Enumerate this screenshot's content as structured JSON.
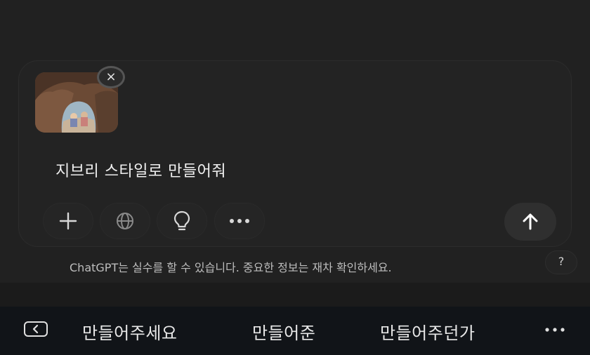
{
  "composer": {
    "attachment": {
      "icon": "image-thumbnail",
      "remove_label": "×"
    },
    "prompt_text": "지브리 스타일로 만들어줘",
    "tools": [
      {
        "icon": "plus-icon"
      },
      {
        "icon": "globe-icon"
      },
      {
        "icon": "lightbulb-icon"
      },
      {
        "icon": "more-icon"
      }
    ],
    "send_icon": "arrow-up-icon"
  },
  "footer": {
    "disclaimer": "ChatGPT는 실수를 할 수 있습니다. 중요한 정보는 재차 확인하세요.",
    "help_label": "?"
  },
  "keyboard_suggestions": {
    "back_icon": "keyboard-back-icon",
    "items": [
      "만들어주세요",
      "만들어준",
      "만들어주던가"
    ],
    "more_icon": "more-icon"
  },
  "colors": {
    "background": "#212121",
    "suggestion_bar": "#111418",
    "text": "#ececec"
  }
}
